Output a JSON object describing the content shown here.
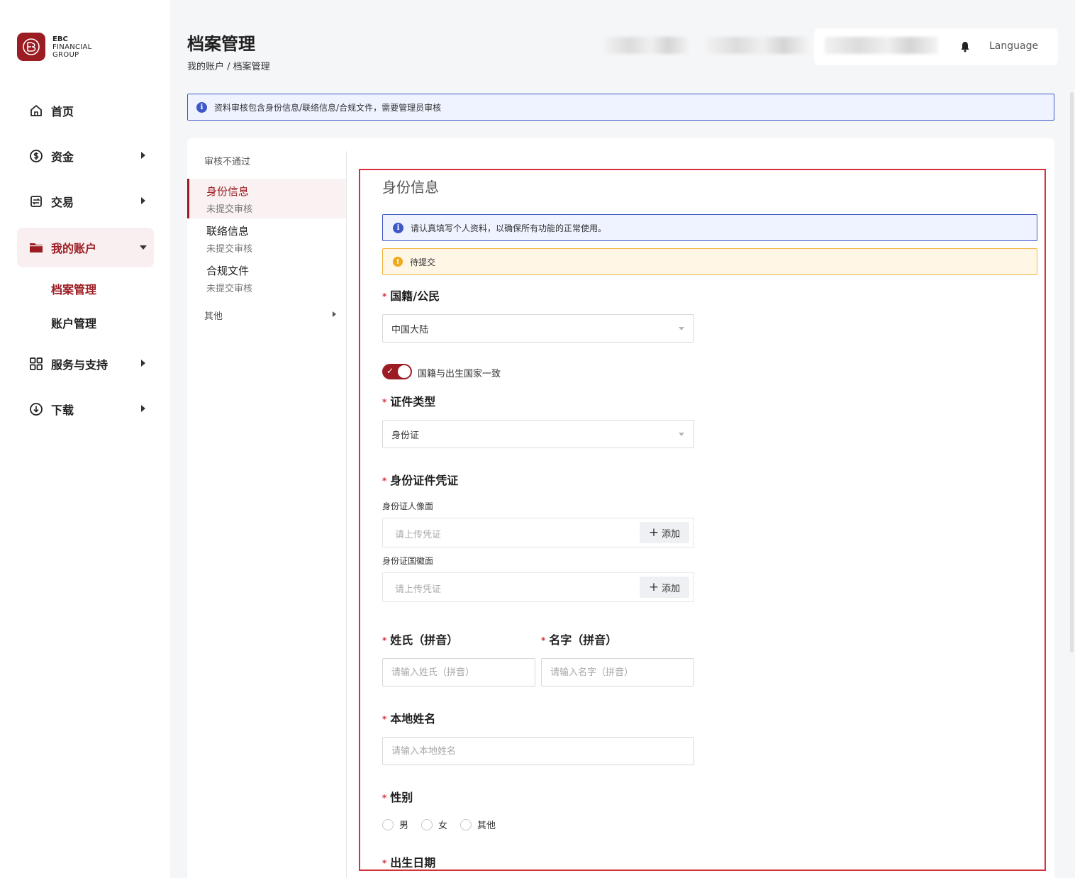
{
  "brand": {
    "line1": "EBC",
    "line2": "FINANCIAL",
    "line3": "GROUP"
  },
  "sidebar": {
    "items": [
      {
        "label": "首页",
        "icon": "home-icon"
      },
      {
        "label": "资金",
        "icon": "dollar-circle-icon"
      },
      {
        "label": "交易",
        "icon": "trade-icon"
      },
      {
        "label": "我的账户",
        "icon": "folder-icon"
      },
      {
        "label": "服务与支持",
        "icon": "grid-icon"
      },
      {
        "label": "下载",
        "icon": "download-icon"
      }
    ],
    "sub_items": [
      {
        "label": "档案管理"
      },
      {
        "label": "账户管理"
      }
    ]
  },
  "header": {
    "title": "档案管理",
    "breadcrumb": "我的账户 / 档案管理",
    "language": "Language"
  },
  "top_alert": "资料审核包含身份信息/联络信息/合规文件，需要管理员审核",
  "subnav": {
    "heading": "审核不通过",
    "entries": [
      {
        "title": "身份信息",
        "status": "未提交审核"
      },
      {
        "title": "联络信息",
        "status": "未提交审核"
      },
      {
        "title": "合规文件",
        "status": "未提交审核"
      }
    ],
    "other": "其他"
  },
  "form": {
    "section_title": "身份信息",
    "info_alert": "请认真填写个人资料，以确保所有功能的正常使用。",
    "warn_alert": "待提交",
    "required_mark": "*",
    "nationality": {
      "label": "国籍/公民",
      "value": "中国大陆"
    },
    "toggle_label": "国籍与出生国家一致",
    "id_type": {
      "label": "证件类型",
      "value": "身份证"
    },
    "id_proof": {
      "label": "身份证件凭证",
      "front_label": "身份证人像面",
      "back_label": "身份证国徽面",
      "placeholder": "请上传凭证",
      "add_label": "添加"
    },
    "surname": {
      "label": "姓氏（拼音）",
      "placeholder": "请输入姓氏（拼音）"
    },
    "given_name": {
      "label": "名字（拼音）",
      "placeholder": "请输入名字（拼音）"
    },
    "local_name": {
      "label": "本地姓名",
      "placeholder": "请输入本地姓名"
    },
    "gender": {
      "label": "性别",
      "options": [
        "男",
        "女",
        "其他"
      ]
    },
    "birth_date": {
      "label": "出生日期"
    }
  },
  "colors": {
    "brand": "#9b1c22",
    "info": "#3e59c7",
    "warn": "#f0b43c",
    "required": "#d6323c"
  }
}
